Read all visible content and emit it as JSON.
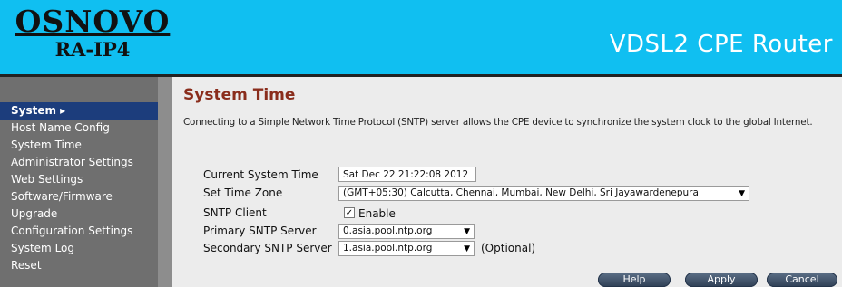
{
  "header": {
    "brand": "OSNOVO",
    "model": "RA-IP4",
    "product_name": "VDSL2 CPE Router"
  },
  "sidebar": {
    "items": [
      {
        "label": "System ▸",
        "active": true
      },
      {
        "label": "Host Name Config"
      },
      {
        "label": "System Time"
      },
      {
        "label": "Administrator Settings"
      },
      {
        "label": "Web Settings"
      },
      {
        "label": "Software/Firmware"
      },
      {
        "label": "Upgrade"
      },
      {
        "label": "Configuration Settings"
      },
      {
        "label": "System Log"
      },
      {
        "label": "Reset"
      }
    ]
  },
  "main": {
    "title": "System Time",
    "description": "Connecting to a Simple Network Time Protocol (SNTP) server allows the CPE device to synchronize the system clock to the global Internet.",
    "form": {
      "current_time_label": "Current System Time",
      "current_time_value": "Sat Dec 22 21:22:08 2012",
      "time_zone_label": "Set Time Zone",
      "time_zone_value": "(GMT+05:30) Calcutta, Chennai, Mumbai, New Delhi, Sri Jayawardenepura",
      "sntp_client_label": "SNTP Client",
      "sntp_enable_label": "Enable",
      "sntp_enabled": true,
      "primary_label": "Primary SNTP Server",
      "primary_value": "0.asia.pool.ntp.org",
      "secondary_label": "Secondary SNTP Server",
      "secondary_value": "1.asia.pool.ntp.org",
      "optional_text": "(Optional)"
    },
    "buttons": {
      "help": "Help",
      "apply": "Apply",
      "cancel": "Cancel"
    }
  },
  "colors": {
    "header_bg": "#10bff1",
    "sidebar_bg": "#6f6f6f",
    "active_item_bg": "#1c3d7c",
    "title_color": "#8a2d1c",
    "content_bg": "#ececec"
  },
  "icons": {
    "dropdown": "chevron-down-icon",
    "checkbox_mark": "check-icon"
  }
}
